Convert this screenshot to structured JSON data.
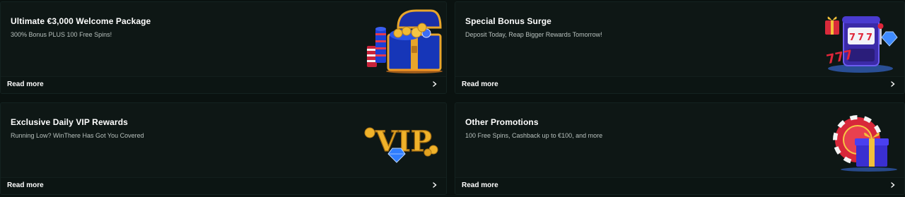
{
  "promotions": [
    {
      "title": "Ultimate €3,000 Welcome Package",
      "description": "300% Bonus PLUS 100 Free Spins!",
      "cta": "Read more",
      "image": "treasure-chest-icon"
    },
    {
      "title": "Special Bonus Surge",
      "description": "Deposit Today, Reap Bigger Rewards Tomorrow!",
      "cta": "Read more",
      "image": "slot-machine-icon"
    },
    {
      "title": "Exclusive Daily VIP Rewards",
      "description": "Running Low? WinThere Has Got You Covered",
      "cta": "Read more",
      "image": "vip-icon"
    },
    {
      "title": "Other Promotions",
      "description": "100 Free Spins, Cashback up to €100, and more",
      "cta": "Read more",
      "image": "casino-chip-gift-icon"
    }
  ],
  "colors": {
    "background": "#0a1210",
    "card": "#0e1715",
    "text": "#ffffff",
    "muted": "#b7c0bd",
    "gold": "#f0b22a",
    "blue": "#2d5bff",
    "red": "#e0263a",
    "purple": "#6a2bd8"
  }
}
